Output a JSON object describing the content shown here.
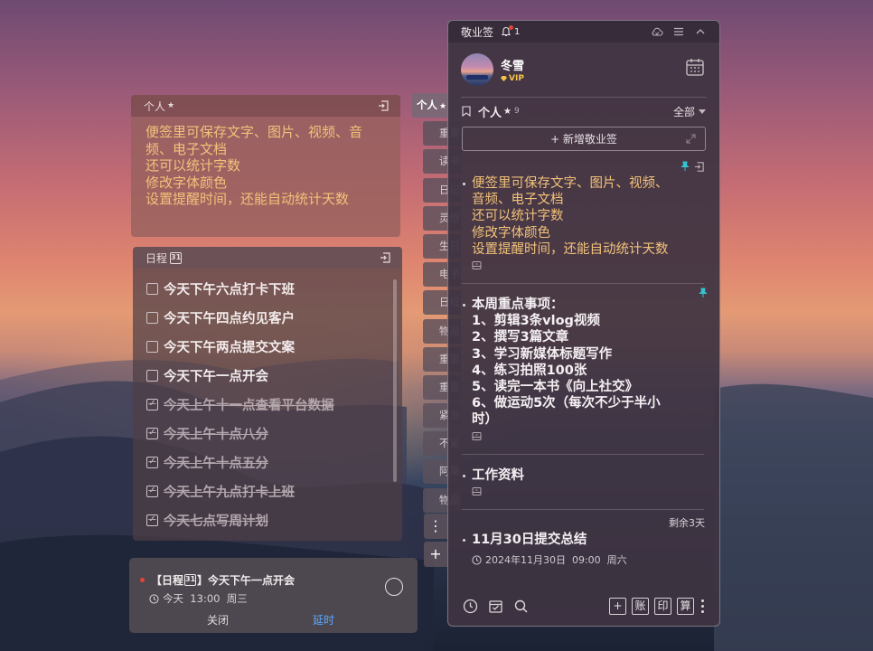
{
  "colors": {
    "note_text": "#f2c27a",
    "pin": "#34c3d0",
    "accent_blue": "#5aa9ff",
    "alert_dot": "#e0453a",
    "vip_gold": "#f5c44a"
  },
  "note_card": {
    "title": "个人",
    "lines": [
      "便签里可保存文字、图片、视频、音",
      "频、电子文档",
      "还可以统计字数",
      "修改字体颜色",
      "设置提醒时间，还能自动统计天数"
    ]
  },
  "schedule_card": {
    "title": "日程",
    "cal_icon_text": "31",
    "items": [
      {
        "text": "今天下午六点打卡下班",
        "done": false
      },
      {
        "text": "今天下午四点约见客户",
        "done": false
      },
      {
        "text": "今天下午两点提交文案",
        "done": false
      },
      {
        "text": "今天下午一点开会",
        "done": false
      },
      {
        "text": "今天上午十一点查看平台数据",
        "done": true
      },
      {
        "text": "今天上午十点八分",
        "done": true
      },
      {
        "text": "今天上午十点五分",
        "done": true
      },
      {
        "text": "今天上午九点打卡上班",
        "done": true
      },
      {
        "text": "今天七点写周计划",
        "done": true
      }
    ]
  },
  "reminder": {
    "prefix": "【日程",
    "suffix": "】今天下午一点开会",
    "time": "今天  13:00  周三",
    "close_label": "关闭",
    "delay_label": "延时"
  },
  "tabs": [
    "个人",
    "重要",
    "读书",
    "日记",
    "灵感",
    "生日",
    "电子",
    "日程",
    "物品",
    "重要",
    "重要",
    "紧急",
    "不紧",
    "阿莱",
    "物品"
  ],
  "tab_more_label": "⋮",
  "tab_add_label": "+",
  "panel": {
    "app_name": "敬业签",
    "bell_count": "1",
    "user_name": "冬雪",
    "vip_label": "VIP",
    "category": "个人",
    "category_star": "★",
    "category_count": "9",
    "filter_label": "全部",
    "new_button_label": "+ 新增敬业签",
    "notes": [
      {
        "text": "便签里可保存文字、图片、视频、\n音频、电子文档\n还可以统计字数\n修改字体颜色\n设置提醒时间，还能自动统计天数",
        "style": "yellow",
        "pinned": true
      },
      {
        "text": "本周重点事项：\n1、剪辑3条vlog视频\n2、撰写3篇文章\n3、学习新媒体标题写作\n4、练习拍照100张\n5、读完一本书《向上社交》\n6、做运动5次（每次不少于半小\n时）",
        "style": "bold",
        "pinned": true
      },
      {
        "text": "工作资料",
        "style": "bold",
        "pinned": false
      },
      {
        "text": "11月30日提交总结",
        "style": "bold",
        "pinned": false,
        "remain": "剩余3天",
        "date": "2024年11月30日  09:00  周六"
      }
    ],
    "bottom_buttons": [
      "+",
      "账",
      "印",
      "算"
    ]
  }
}
